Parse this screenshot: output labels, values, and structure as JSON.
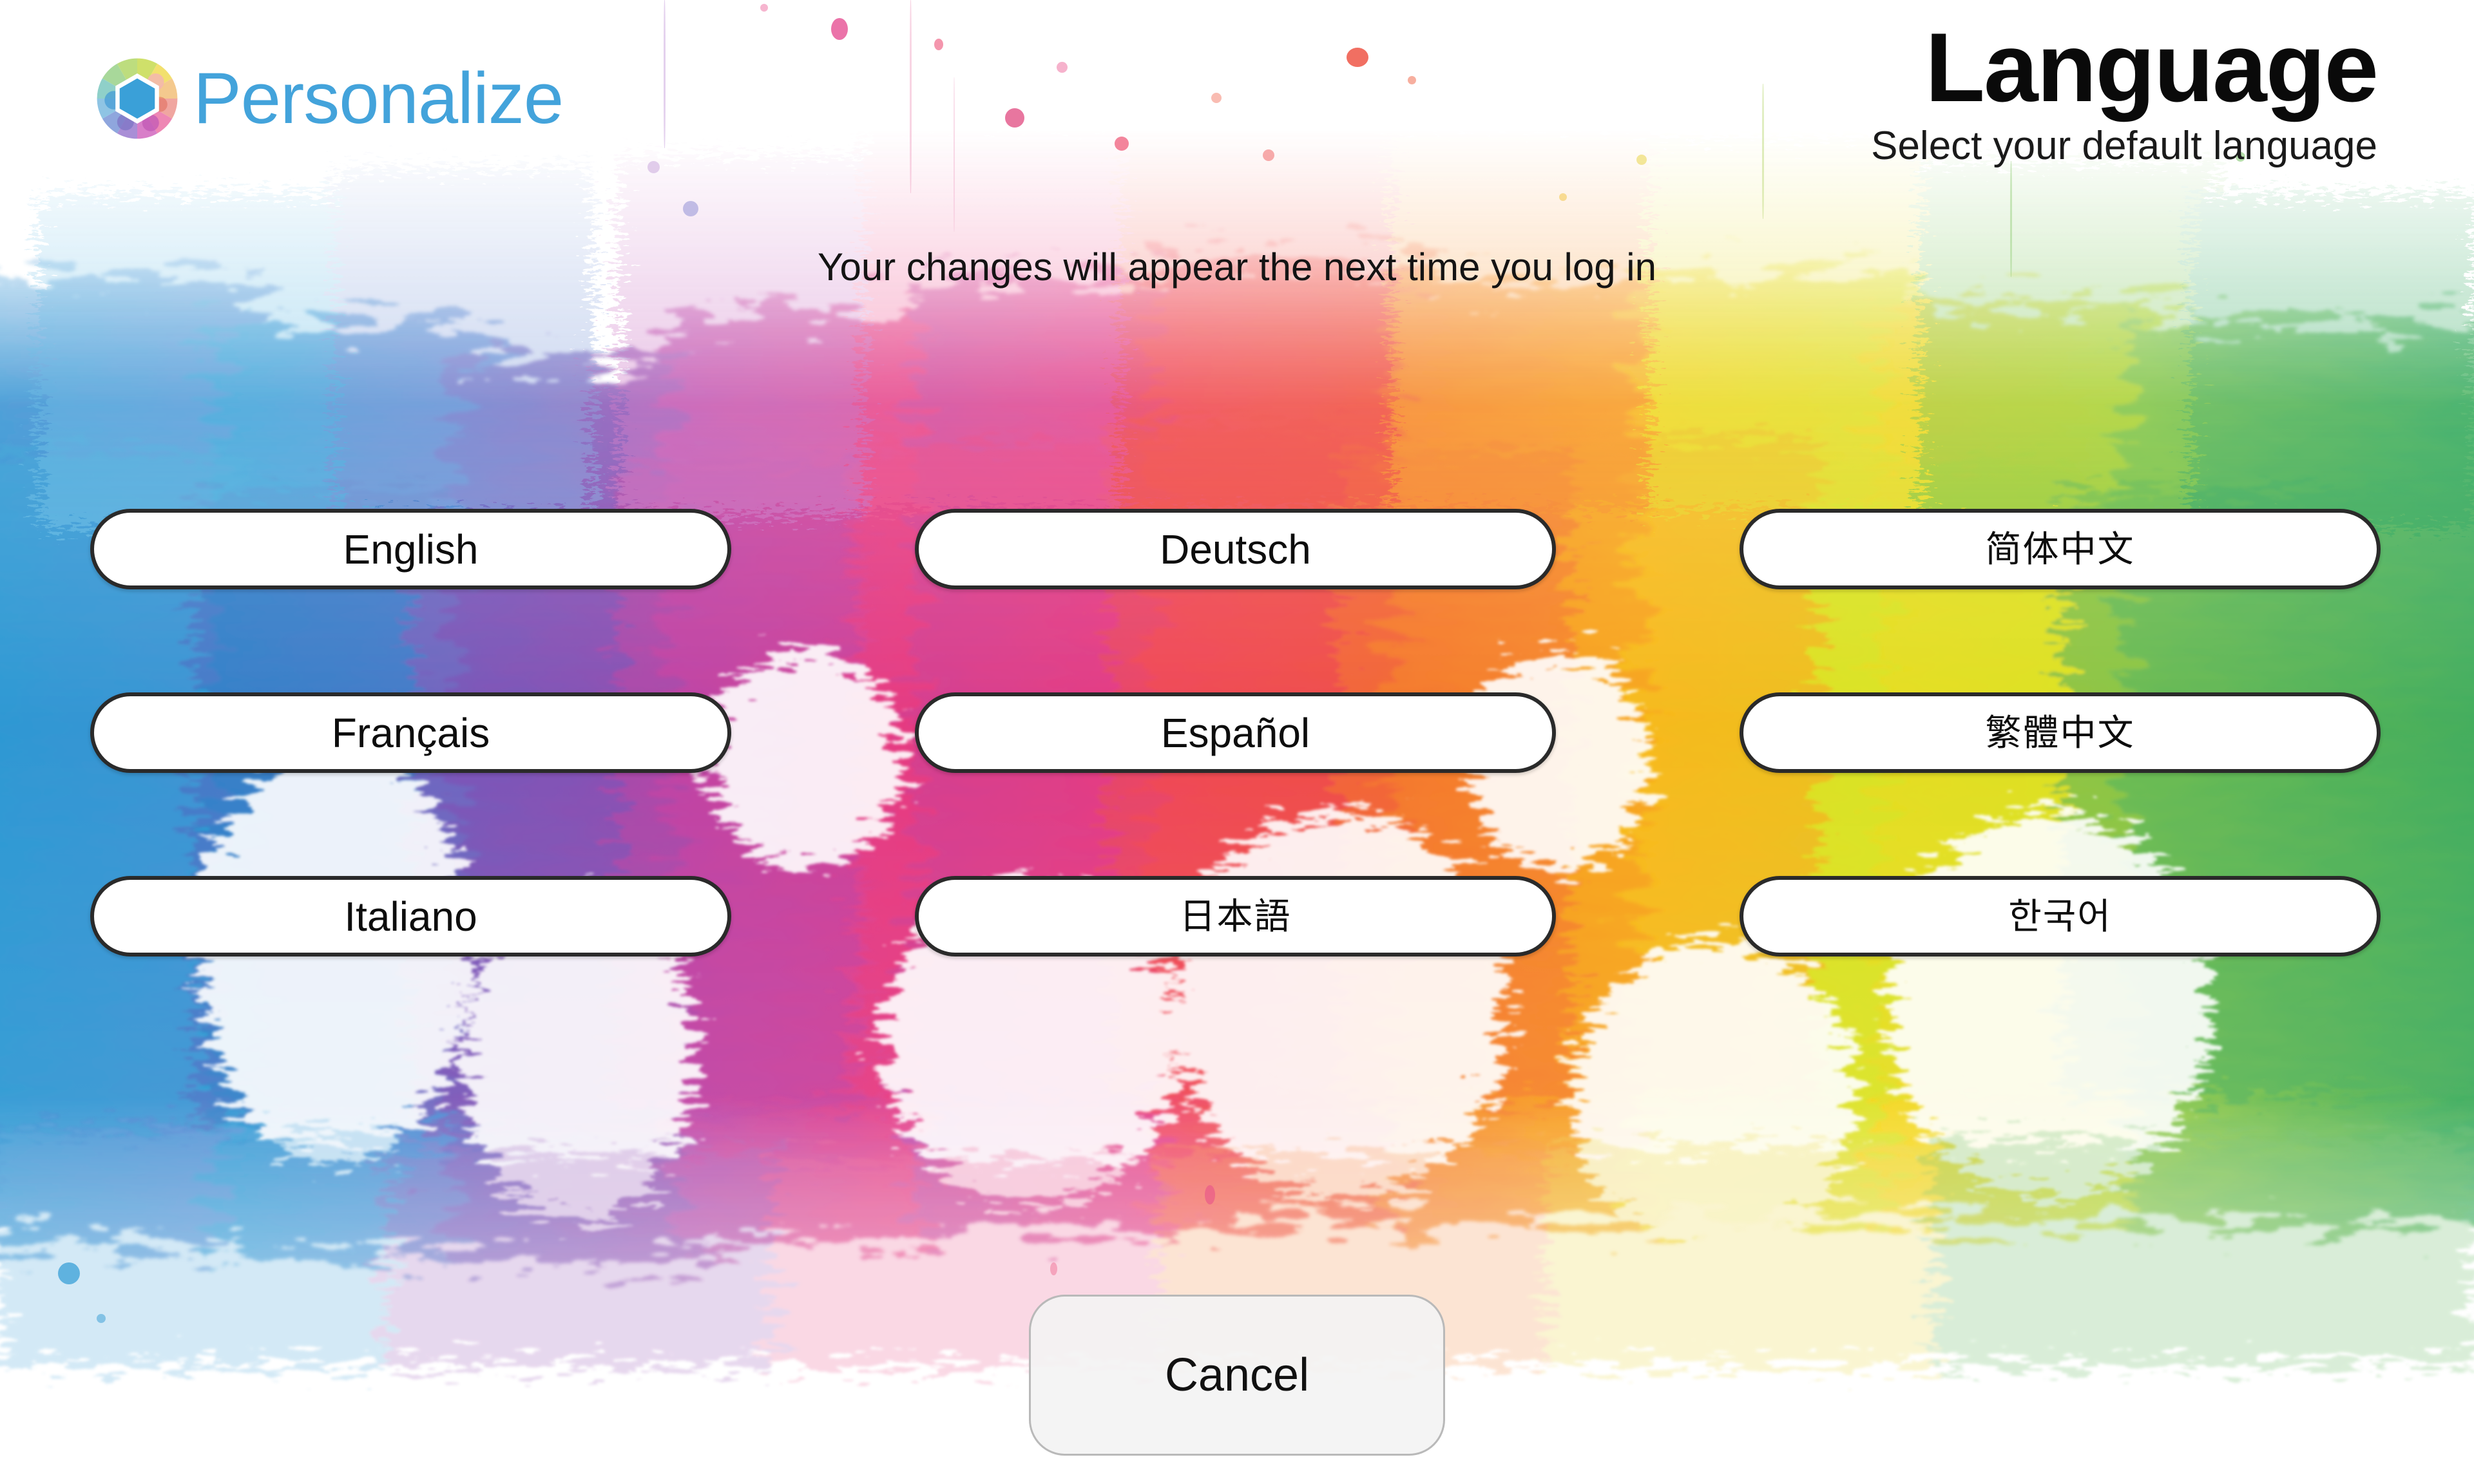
{
  "brand": {
    "name": "Personalize",
    "logo_icon": "color-wheel-icon",
    "logo_color": "#43a3db"
  },
  "header": {
    "title": "Language",
    "subtitle": "Select your default language",
    "notice": "Your changes will appear the next time you log in"
  },
  "languages": [
    {
      "label": "English",
      "script": "latin"
    },
    {
      "label": "Deutsch",
      "script": "latin"
    },
    {
      "label": "简体中文",
      "script": "cjk"
    },
    {
      "label": "Français",
      "script": "latin"
    },
    {
      "label": "Español",
      "script": "latin"
    },
    {
      "label": "繁體中文",
      "script": "cjk"
    },
    {
      "label": "Italiano",
      "script": "latin"
    },
    {
      "label": "日本語",
      "script": "cjk"
    },
    {
      "label": "한국어",
      "script": "cjk"
    }
  ],
  "actions": {
    "cancel_label": "Cancel"
  },
  "theme": {
    "button_background": "#ffffff",
    "button_border": "#2a2a2a",
    "text_color": "#0d0d0d",
    "cancel_background": "#f3f3f3",
    "cancel_border": "#b9b9b9",
    "page_background": "#ffffff",
    "watercolor_palette": [
      "#2f9fd4",
      "#3f6fc0",
      "#7b4fb0",
      "#a14aa8",
      "#d63f9a",
      "#e8397a",
      "#ef4a4a",
      "#f4722f",
      "#f7a31e",
      "#f5cf1c",
      "#d7e222",
      "#8dc63f",
      "#36a85a"
    ]
  }
}
